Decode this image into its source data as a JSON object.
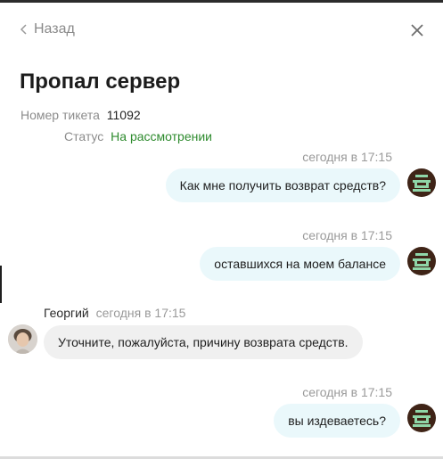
{
  "header": {
    "back_label": "Назад",
    "title": "Пропал сервер"
  },
  "ticket": {
    "number_label": "Номер тикета",
    "number_value": "11092",
    "status_label": "Статус",
    "status_value": "На рассмотрении",
    "status_color": "#2e8b2e"
  },
  "messages": [
    {
      "direction": "outgoing",
      "time": "сегодня в 17:15",
      "text": "Как мне получить возврат средств?"
    },
    {
      "direction": "outgoing",
      "time": "сегодня в 17:15",
      "text": "оставшихся на моем балансе"
    },
    {
      "direction": "incoming",
      "sender": "Георгий",
      "time": "сегодня в 17:15",
      "text": "Уточните, пожалуйста, причину возврата средств."
    },
    {
      "direction": "outgoing",
      "time": "сегодня в 17:15",
      "text": "вы издеваетесь?"
    }
  ],
  "icons": {
    "back": "chevron-left-icon",
    "close": "close-icon",
    "user_avatar": "user-avatar-icon",
    "agent_avatar": "agent-avatar"
  },
  "colors": {
    "outgoing_bubble": "#eaf8fb",
    "incoming_bubble": "#f0f0f0",
    "user_avatar_bg": "#3f2417",
    "user_avatar_fg": "#8fd6a8"
  }
}
